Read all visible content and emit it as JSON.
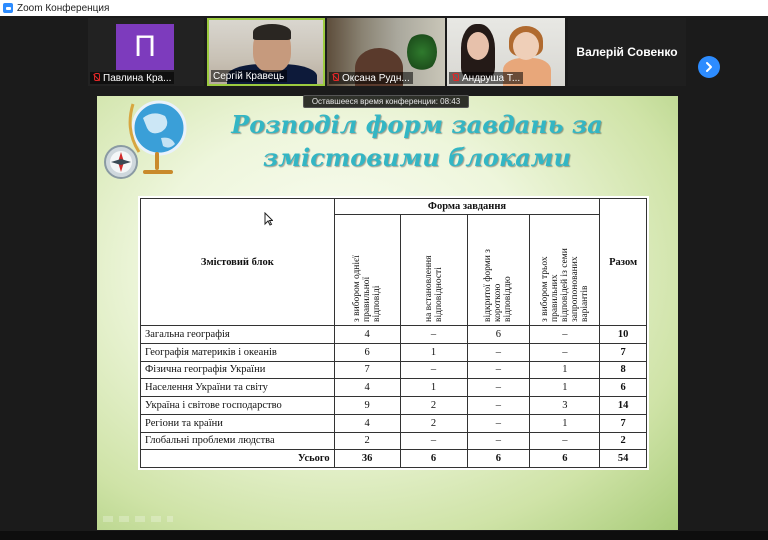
{
  "window": {
    "title": "Zoom Конференция"
  },
  "participants": [
    {
      "name": "Павлина Кра...",
      "avatar_letter": "П",
      "avatar_color": "#7d3bbd",
      "muted": true
    },
    {
      "name": "Сергій Кравець",
      "muted": false,
      "active_speaker": true
    },
    {
      "name": "Оксана Рудн...",
      "muted": true
    },
    {
      "name": "Андруша Т...",
      "muted": true
    },
    {
      "name": "Валерій Совенко",
      "video": false
    }
  ],
  "timer_text": "Оставшееся время конференции: 08:43",
  "slide": {
    "title_line1": "Розподіл форм завдань за",
    "title_line2": "змістовими блоками",
    "table": {
      "header_block": "Змістовий блок",
      "header_forms": "Форма завдання",
      "header_total": "Разом",
      "form_cols": [
        "з вибором однієї\nправильної\nвідповіді",
        "на встановлення\nвідповідності",
        "відкритої форми з\nкороткою\nвідповіддю",
        "з вибором трьох\nправильних\nвідповідей із семи\nзапропонованих\nваріантів"
      ],
      "rows": [
        {
          "label": "Загальна географія",
          "c1": "4",
          "c2": "–",
          "c3": "6",
          "c4": "–",
          "total": "10"
        },
        {
          "label": "Географія материків і океанів",
          "c1": "6",
          "c2": "1",
          "c3": "–",
          "c4": "–",
          "total": "7"
        },
        {
          "label": "Фізична географія України",
          "c1": "7",
          "c2": "–",
          "c3": "–",
          "c4": "1",
          "total": "8"
        },
        {
          "label": "Населення України та світу",
          "c1": "4",
          "c2": "1",
          "c3": "–",
          "c4": "1",
          "total": "6"
        },
        {
          "label": "Україна і світове господарство",
          "c1": "9",
          "c2": "2",
          "c3": "–",
          "c4": "3",
          "total": "14"
        },
        {
          "label": "Регіони та країни",
          "c1": "4",
          "c2": "2",
          "c3": "–",
          "c4": "1",
          "total": "7"
        },
        {
          "label": "Глобальні проблеми людства",
          "c1": "2",
          "c2": "–",
          "c3": "–",
          "c4": "–",
          "total": "2"
        }
      ],
      "total_row": {
        "label": "Усього",
        "c1": "36",
        "c2": "6",
        "c3": "6",
        "c4": "6",
        "total": "54"
      }
    }
  },
  "colors": {
    "accent": "#2d8cff",
    "speaker_border": "#9ccb3f",
    "title_color": "#33b6c4"
  }
}
